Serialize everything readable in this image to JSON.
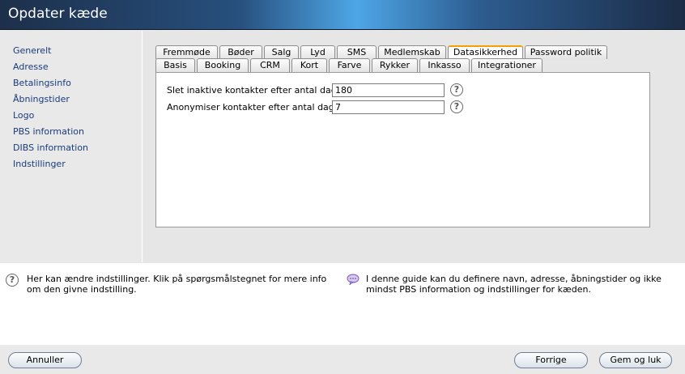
{
  "window": {
    "title": "Opdater kæde"
  },
  "sidebar": {
    "items": [
      {
        "label": "Generelt"
      },
      {
        "label": "Adresse"
      },
      {
        "label": "Betalingsinfo"
      },
      {
        "label": "Åbningstider"
      },
      {
        "label": "Logo"
      },
      {
        "label": "PBS information"
      },
      {
        "label": "DIBS information"
      },
      {
        "label": "Indstillinger"
      }
    ]
  },
  "tabs": {
    "row1": [
      "Fremmøde",
      "Bøder",
      "Salg",
      "Lyd",
      "SMS",
      "Medlemskab",
      "Datasikkerhed",
      "Password politik"
    ],
    "row2": [
      "Basis",
      "Booking",
      "CRM",
      "Kort",
      "Farve",
      "Rykker",
      "Inkasso",
      "Integrationer"
    ],
    "active": "Datasikkerhed"
  },
  "form": {
    "fields": [
      {
        "label": "Slet inaktive kontakter efter antal dage:",
        "value": "180"
      },
      {
        "label": "Anonymiser kontakter efter antal dage:",
        "value": "7"
      }
    ],
    "help_glyph": "?"
  },
  "info": {
    "help_text": "Her kan ændre indstillinger. Klik på spørgsmålstegnet for mere info om den givne indstilling.",
    "guide_text": "I denne guide kan du definere navn, adresse, åbningstider og ikke mindst PBS information og indstillinger for kæden.",
    "help_icon": "question-circle-icon",
    "guide_icon": "speech-bubble-icon"
  },
  "footer": {
    "cancel_label": "Annuller",
    "prev_label": "Forrige",
    "save_label": "Gem og luk"
  }
}
